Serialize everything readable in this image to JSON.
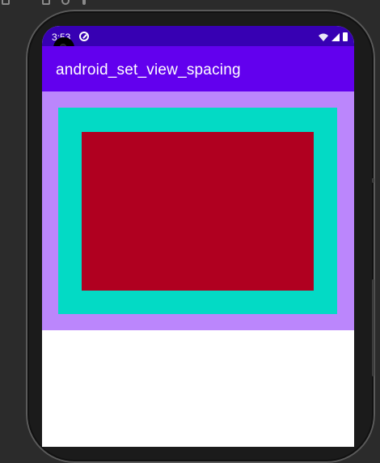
{
  "status_bar": {
    "time": "3:53",
    "icons": [
      "app-notification-icon",
      "wifi-icon",
      "signal-icon",
      "battery-icon"
    ]
  },
  "app_bar": {
    "title": "android_set_view_spacing"
  },
  "colors": {
    "status_bar": "#3700b3",
    "app_bar": "#6200ee",
    "outer_layout": "#bb86fc",
    "middle_view": "#03dac5",
    "inner_view": "#b00020",
    "screen_background": "#ffffff",
    "ide_background": "#2b2b2b"
  }
}
